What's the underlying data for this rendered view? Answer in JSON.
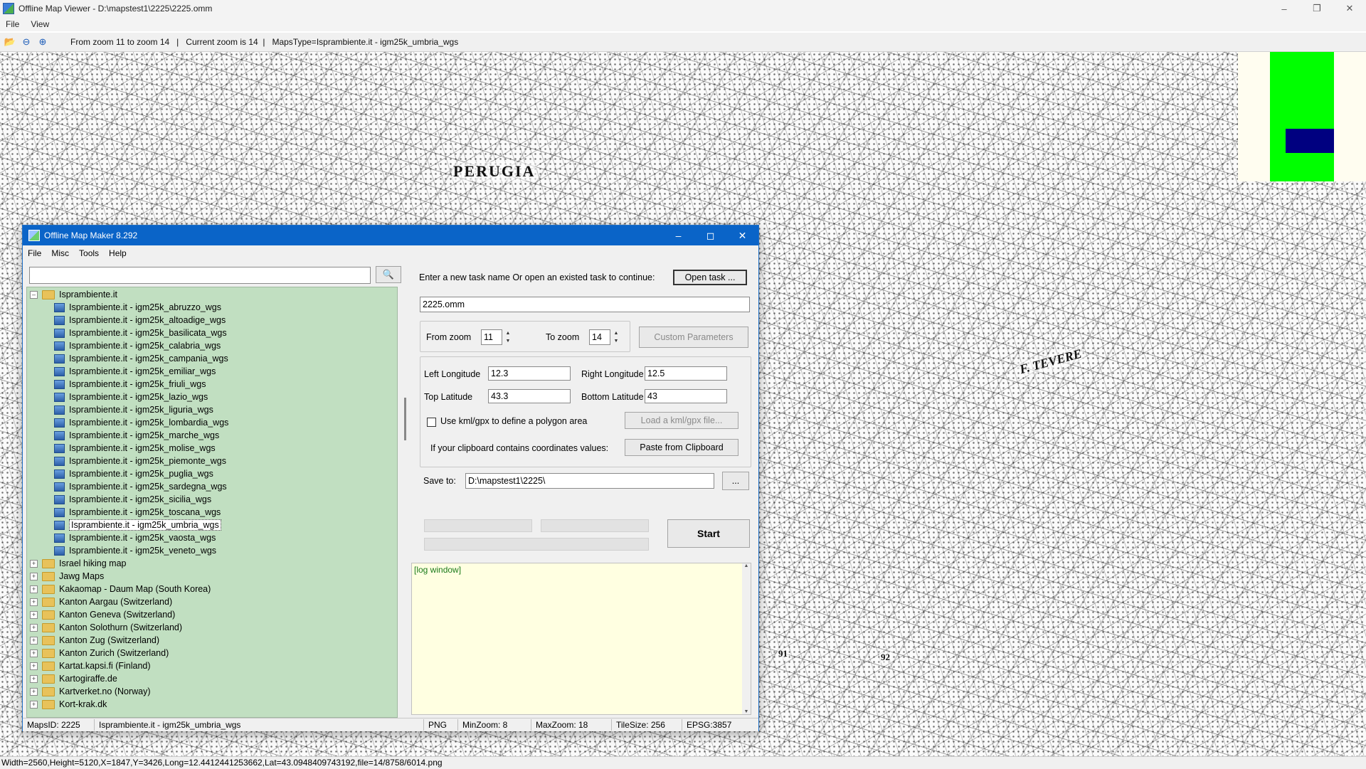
{
  "viewer": {
    "title": "Offline Map Viewer - D:\\mapstest1\\2225\\2225.omm",
    "menu": [
      "File",
      "View"
    ],
    "toolbar_info": "From zoom 11 to zoom 14   |   Current zoom is 14  |   MapsType=Isprambiente.it - igm25k_umbria_wgs",
    "toolbar_icons": [
      "open-folder-icon",
      "zoom-out-icon",
      "zoom-in-icon"
    ],
    "map_labels": [
      "PERUGIA",
      "F. TEVERE",
      "91",
      "92"
    ],
    "status": "Width=2560,Height=5120,X=1847,Y=3426,Long=12.4412441253662,Lat=43.0948409743192,file=14/8758/6014.png",
    "overview_colors": {
      "background": "#fffdf0",
      "extent": "#00ff00",
      "view": "#000080"
    }
  },
  "dialog": {
    "title": "Offline Map Maker 8.292",
    "menu": [
      "File",
      "Misc",
      "Tools",
      "Help"
    ],
    "search": {
      "value": "",
      "placeholder": ""
    },
    "tree": {
      "root": "Isprambiente.it",
      "children": [
        "Isprambiente.it - igm25k_abruzzo_wgs",
        "Isprambiente.it - igm25k_altoadige_wgs",
        "Isprambiente.it - igm25k_basilicata_wgs",
        "Isprambiente.it - igm25k_calabria_wgs",
        "Isprambiente.it - igm25k_campania_wgs",
        "Isprambiente.it - igm25k_emiliar_wgs",
        "Isprambiente.it - igm25k_friuli_wgs",
        "Isprambiente.it - igm25k_lazio_wgs",
        "Isprambiente.it - igm25k_liguria_wgs",
        "Isprambiente.it - igm25k_lombardia_wgs",
        "Isprambiente.it - igm25k_marche_wgs",
        "Isprambiente.it - igm25k_molise_wgs",
        "Isprambiente.it - igm25k_piemonte_wgs",
        "Isprambiente.it - igm25k_puglia_wgs",
        "Isprambiente.it - igm25k_sardegna_wgs",
        "Isprambiente.it - igm25k_sicilia_wgs",
        "Isprambiente.it - igm25k_toscana_wgs",
        "Isprambiente.it - igm25k_umbria_wgs",
        "Isprambiente.it - igm25k_vaosta_wgs",
        "Isprambiente.it - igm25k_veneto_wgs"
      ],
      "selected": "Isprambiente.it - igm25k_umbria_wgs",
      "folders": [
        "Israel hiking map",
        "Jawg Maps",
        "Kakaomap - Daum Map (South Korea)",
        "Kanton Aargau (Switzerland)",
        "Kanton Geneva (Switzerland)",
        "Kanton Solothurn (Switzerland)",
        "Kanton Zug (Switzerland)",
        "Kanton Zurich (Switzerland)",
        "Kartat.kapsi.fi (Finland)",
        "Kartogiraffe.de",
        "Kartverket.no (Norway)",
        "Kort-krak.dk"
      ]
    },
    "task_prompt": "Enter a new task name Or open an existed task to continue:",
    "open_task_label": "Open task ...",
    "task_name": "2225.omm",
    "from_zoom_label": "From zoom",
    "from_zoom": "11",
    "to_zoom_label": "To zoom",
    "to_zoom": "14",
    "custom_params_label": "Custom Parameters",
    "left_lon_label": "Left Longitude",
    "left_lon": "12.3",
    "right_lon_label": "Right Longitude",
    "right_lon": "12.5",
    "top_lat_label": "Top Latitude",
    "top_lat": "43.3",
    "bottom_lat_label": "Bottom Latitude",
    "bottom_lat": "43",
    "kml_checkbox_label": "Use kml/gpx to define a polygon area",
    "kml_checked": false,
    "load_kml_label": "Load a kml/gpx file...",
    "clipboard_label": "If your clipboard contains coordinates values:",
    "paste_label": "Paste from Clipboard",
    "save_to_label": "Save to:",
    "save_to": "D:\\mapstest1\\2225\\",
    "browse_label": "...",
    "start_label": "Start",
    "log_text": "[log window]",
    "status": {
      "maps_id": "MapsID: 2225",
      "maps_name": "Isprambiente.it - igm25k_umbria_wgs",
      "format": "PNG",
      "min_zoom": "MinZoom: 8",
      "max_zoom": "MaxZoom: 18",
      "tile_size": "TileSize: 256",
      "epsg": "EPSG:3857"
    }
  }
}
